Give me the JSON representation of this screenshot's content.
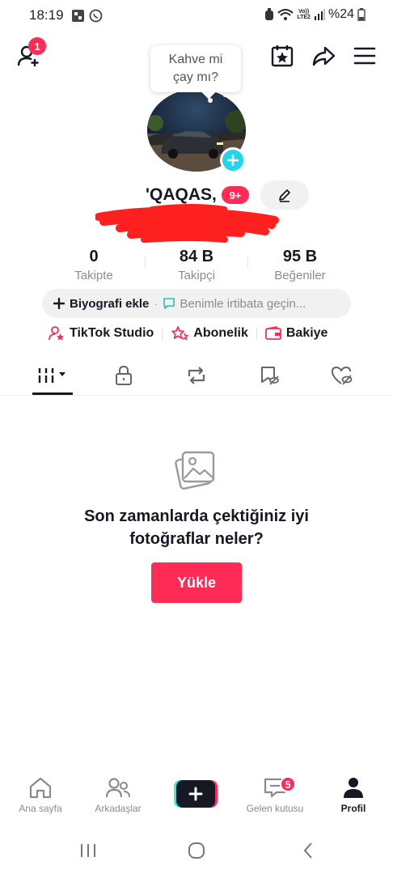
{
  "status_bar": {
    "time": "18:19",
    "volte_line1": "Vo))",
    "volte_line2": "LTE2",
    "battery": "%24"
  },
  "header": {
    "friend_requests_badge": "1"
  },
  "tooltip": {
    "line1": "Kahve mi",
    "line2": "çay mı?"
  },
  "profile": {
    "username": "'QAQAS,",
    "notification_badge": "9+"
  },
  "stats": [
    {
      "value": "0",
      "label": "Takipte"
    },
    {
      "value": "84 B",
      "label": "Takipçi"
    },
    {
      "value": "95 B",
      "label": "Beğeniler"
    }
  ],
  "bio": {
    "add_label": "Biyografi ekle",
    "separator": "·",
    "contact_label": "Benimle irtibata geçin..."
  },
  "tools": [
    {
      "label": "TikTok Studio",
      "icon": "person-star-icon"
    },
    {
      "label": "Abonelik",
      "icon": "stars-icon"
    },
    {
      "label": "Bakiye",
      "icon": "wallet-icon"
    }
  ],
  "empty_state": {
    "line1": "Son zamanlarda çektiğiniz iyi",
    "line2": "fotoğraflar neler?",
    "button": "Yükle"
  },
  "bottom_nav": [
    {
      "label": "Ana sayfa",
      "icon": "home-icon"
    },
    {
      "label": "Arkadaşlar",
      "icon": "friends-icon"
    },
    {
      "label": "Gelen kutusu",
      "icon": "inbox-icon",
      "badge": "5"
    },
    {
      "label": "Profil",
      "icon": "profile-icon",
      "active": true
    }
  ],
  "colors": {
    "accent": "#fe2c55",
    "cyan": "#20d5ec",
    "text": "#161823",
    "muted": "#8a8b91"
  }
}
